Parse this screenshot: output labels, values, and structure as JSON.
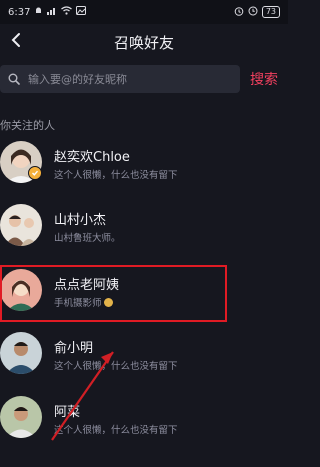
{
  "status_bar": {
    "time": "6:37",
    "battery": "73",
    "accent": "#dcdce2"
  },
  "nav": {
    "title": "召唤好友",
    "back_icon": "chevron-left-icon"
  },
  "search": {
    "placeholder": "输入要@的好友昵称",
    "action": "搜索",
    "action_color": "#f2405f"
  },
  "section": {
    "label": "你关注的人"
  },
  "friends": [
    {
      "name": "赵奕欢Chloe",
      "bio": "这个人很懒，什么也没有留下",
      "verified": true
    },
    {
      "name": "山村小杰",
      "bio": "山村鲁班大师。",
      "verified": false
    },
    {
      "name": "点点老阿姨",
      "bio": "手机摄影师",
      "verified": false,
      "emoji": "smile-emoji"
    },
    {
      "name": "俞小明",
      "bio": "这个人很懒，什么也没有留下",
      "verified": false
    },
    {
      "name": "阿菜",
      "bio": "这个人很懒，什么也没有留下",
      "verified": false
    }
  ],
  "annotation": {
    "highlight_color": "#e01b24"
  }
}
